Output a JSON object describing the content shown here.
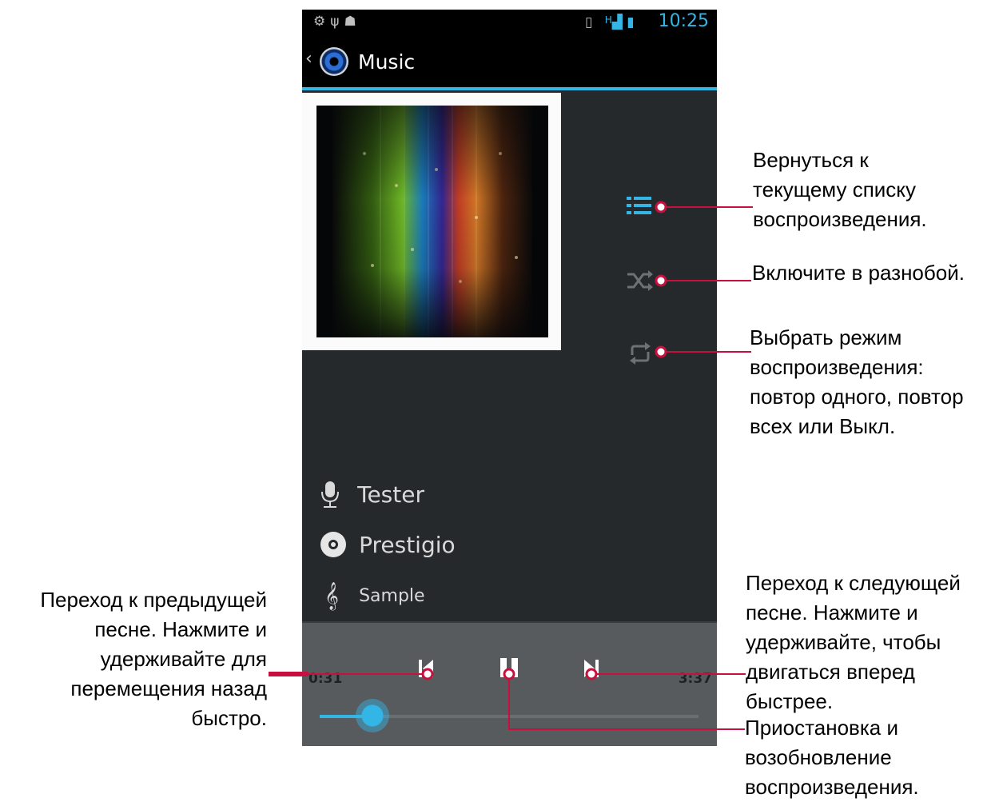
{
  "status_bar": {
    "left_icons": [
      "settings-icon",
      "usb-icon",
      "android-debug-icon"
    ],
    "right_icons": [
      "vibrate-icon",
      "hspa-signal-icon",
      "battery-charging-icon"
    ],
    "network_label": "H",
    "time": "10:25"
  },
  "action_bar": {
    "back_glyph": "‹",
    "title": "Music"
  },
  "side_controls": [
    {
      "name": "playlist-icon",
      "color": "#33b5e5"
    },
    {
      "name": "shuffle-icon",
      "color": "#6e7174"
    },
    {
      "name": "repeat-icon",
      "color": "#6e7174"
    }
  ],
  "track": {
    "artist": "Tester",
    "album": "Prestigio",
    "title": "Sample"
  },
  "player": {
    "elapsed": "0:31",
    "duration": "3:37",
    "progress_fraction": 0.14,
    "state": "playing"
  },
  "annotations": {
    "playlist": "Вернуться к текущему списку воспроизведения.",
    "playlist_lines": [
      "Вернуться к",
      "текущему списку",
      "воспроизведения."
    ],
    "shuffle": "Включите в разнобой.",
    "repeat_lines": [
      "Выбрать режим",
      "воспроизведения:",
      "повтор одного, повтор",
      "всех или Выкл."
    ],
    "prev_lines": [
      "Переход к предыдущей",
      "песне. Нажмите и",
      "удерживайте для",
      "перемещения назад",
      "быстро."
    ],
    "next_lines": [
      "Переход к следующей",
      "песне. Нажмите и",
      "удерживайте, чтобы",
      "двигаться вперед",
      "быстрее."
    ],
    "pause_lines": [
      "Приостановка и",
      "возобновление",
      "воспроизведения."
    ]
  },
  "colors": {
    "accent": "#33b5e5",
    "leader": "#c8103e",
    "screen_bg": "#26292c",
    "player_bg": "#585b5e"
  }
}
